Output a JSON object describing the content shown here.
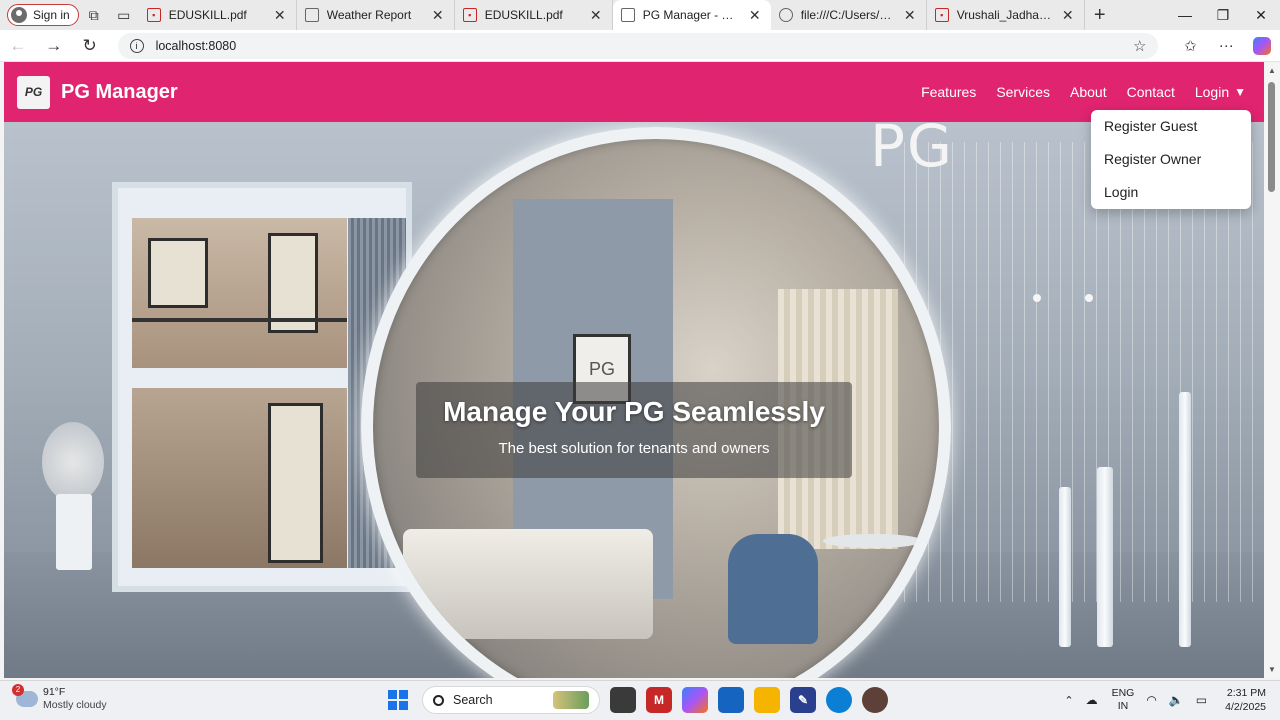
{
  "browser": {
    "signin_label": "Sign in",
    "tabs": [
      {
        "title": "EDUSKILL.pdf",
        "favicon": "pdf-icon"
      },
      {
        "title": "Weather Report",
        "favicon": "document-icon"
      },
      {
        "title": "EDUSKILL.pdf",
        "favicon": "pdf-icon"
      },
      {
        "title": "PG Manager - Home",
        "favicon": "document-icon",
        "active": true
      },
      {
        "title": "file:///C:/Users/asus/Des",
        "favicon": "file-icon"
      },
      {
        "title": "Vrushali_Jadhav_Resume",
        "favicon": "pdf-icon"
      }
    ],
    "url": "localhost:8080"
  },
  "site": {
    "logo_text": "PG",
    "brand": "PG Manager",
    "brand_color": "#e1246f",
    "nav": {
      "features": "Features",
      "services": "Services",
      "about": "About",
      "contact": "Contact",
      "login": "Login"
    },
    "dropdown": {
      "register_guest": "Register Guest",
      "register_owner": "Register Owner",
      "login": "Login"
    },
    "hero": {
      "image_text": "PG",
      "frame_text": "PG",
      "title": "Manage Your PG Seamlessly",
      "subtitle": "The best solution for tenants and owners"
    }
  },
  "taskbar": {
    "weather_badge": "2",
    "temperature": "91°F",
    "condition": "Mostly cloudy",
    "search_label": "Search",
    "lang_top": "ENG",
    "lang_bottom": "IN",
    "time": "2:31 PM",
    "date": "4/2/2025"
  }
}
